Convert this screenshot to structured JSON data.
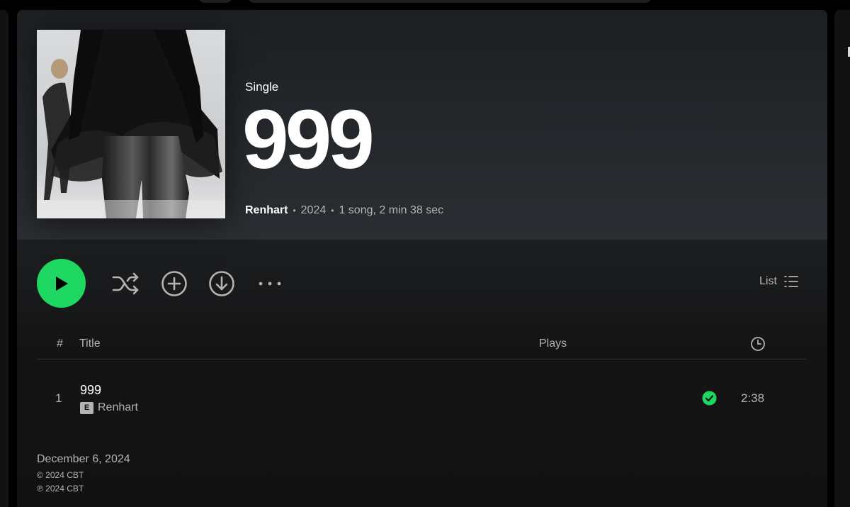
{
  "album": {
    "type": "Single",
    "title": "999",
    "artist": "Renhart",
    "year": "2024",
    "stats": "1 song, 2 min 38 sec"
  },
  "controls": {
    "view_label": "List"
  },
  "table": {
    "headers": {
      "number": "#",
      "title": "Title",
      "plays": "Plays"
    },
    "tracks": [
      {
        "number": "1",
        "title": "999",
        "explicit_badge": "E",
        "artist": "Renhart",
        "duration": "2:38"
      }
    ]
  },
  "footer": {
    "release_date": "December 6, 2024",
    "copyright": "© 2024 CBT",
    "phonogram": "℗ 2024 CBT"
  },
  "colors": {
    "accent_green": "#1ed760",
    "text_secondary": "#b3b3b3",
    "background": "#121212"
  },
  "icons": {
    "play": "play-icon",
    "shuffle": "shuffle-icon",
    "add": "plus-circle-icon",
    "download": "download-circle-icon",
    "more": "more-horizontal-icon",
    "list": "list-icon",
    "clock": "clock-icon",
    "saved": "check-circle-icon"
  }
}
